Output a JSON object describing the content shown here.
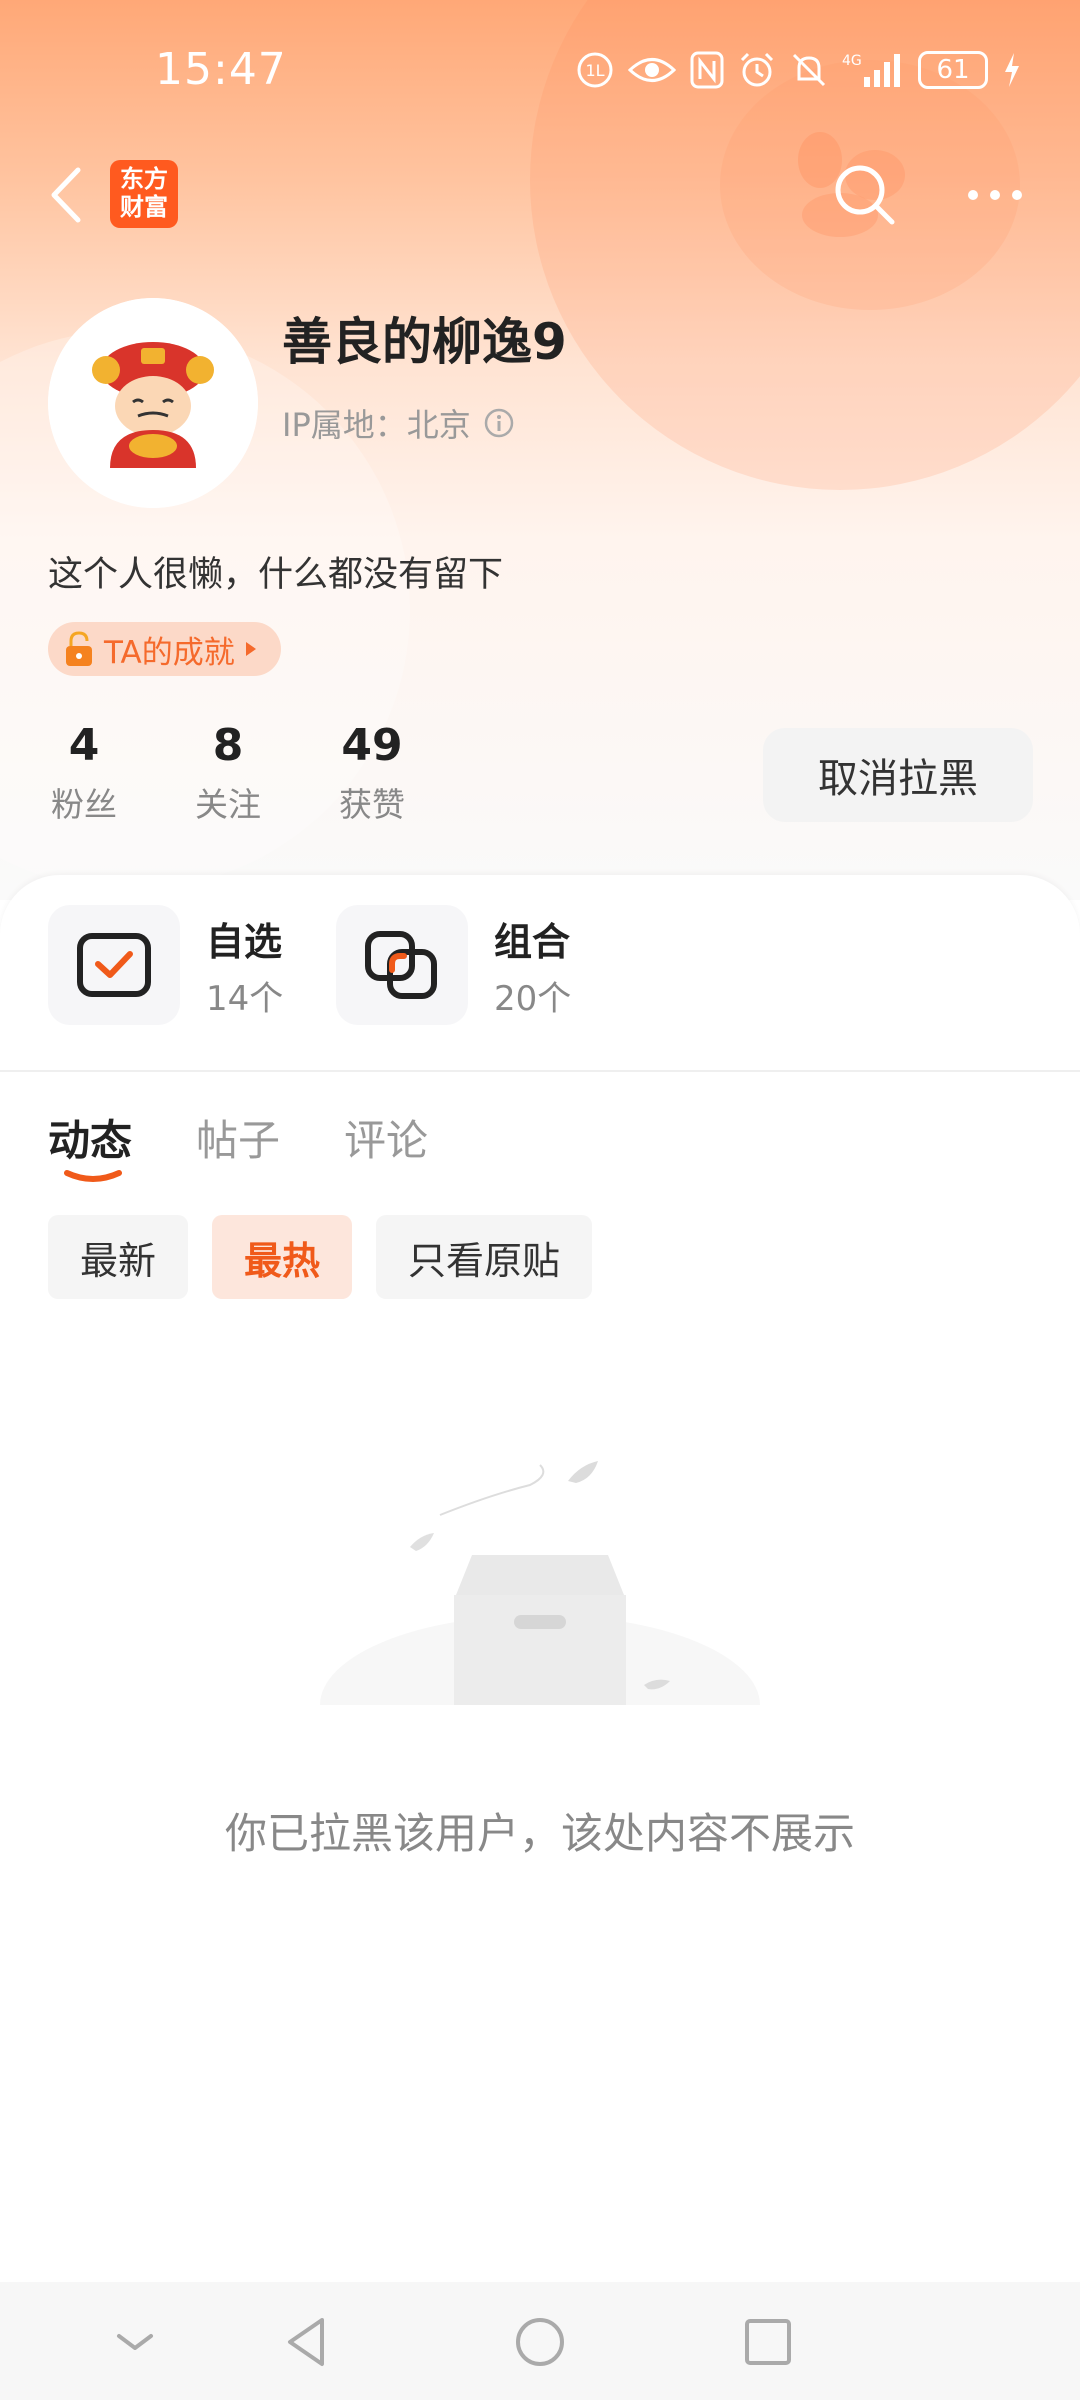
{
  "status_bar": {
    "time": "15:47",
    "network": "4G",
    "battery": "61"
  },
  "nav": {
    "logo_line1": "东方",
    "logo_line2": "财富"
  },
  "profile": {
    "username": "善良的柳逸9",
    "ip_label": "IP属地：北京",
    "bio": "这个人很懒，什么都没有留下",
    "achievement_label": "TA的成就"
  },
  "stats": [
    {
      "num": "4",
      "label": "粉丝"
    },
    {
      "num": "8",
      "label": "关注"
    },
    {
      "num": "49",
      "label": "获赞"
    }
  ],
  "unblock_button": "取消拉黑",
  "quick_links": [
    {
      "title": "自选",
      "count": "14个"
    },
    {
      "title": "组合",
      "count": "20个"
    }
  ],
  "tabs": [
    {
      "label": "动态",
      "active": true
    },
    {
      "label": "帖子",
      "active": false
    },
    {
      "label": "评论",
      "active": false
    }
  ],
  "filters": [
    {
      "label": "最新",
      "active": false
    },
    {
      "label": "最热",
      "active": true
    },
    {
      "label": "只看原贴",
      "active": false
    }
  ],
  "empty_message": "你已拉黑该用户，该处内容不展示",
  "colors": {
    "accent": "#f05a1a",
    "logo_bg": "#ff5a1f"
  }
}
